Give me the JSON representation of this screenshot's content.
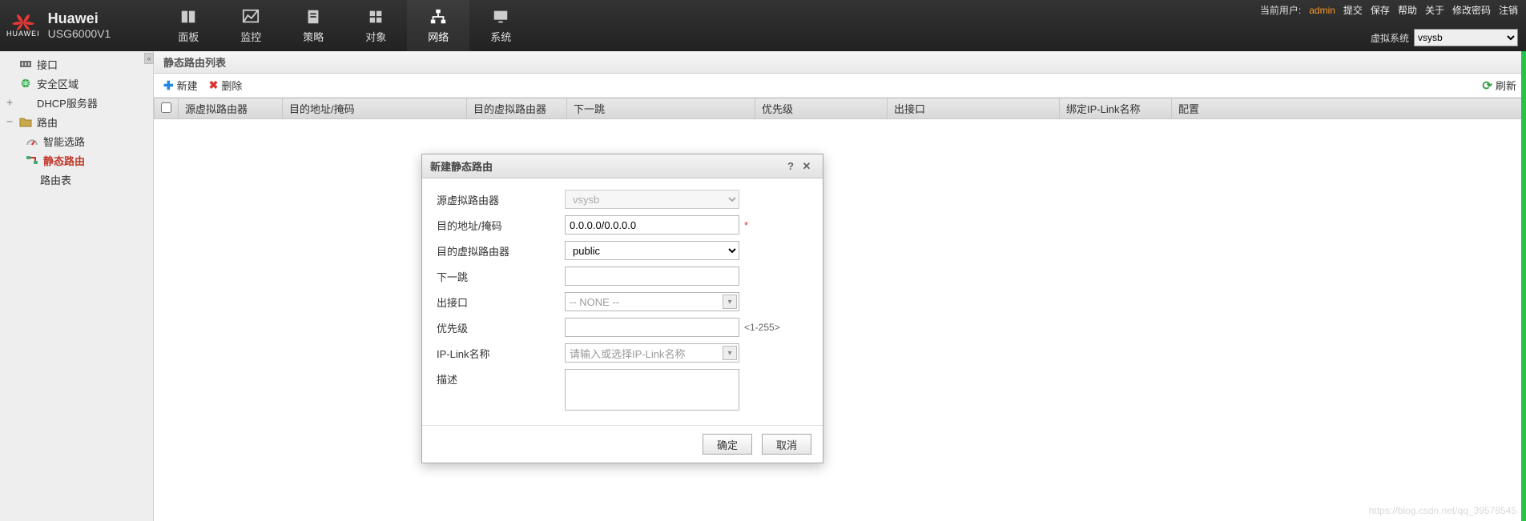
{
  "brand": {
    "name": "Huawei",
    "model": "USG6000V1",
    "logo_label": "HUAWEI"
  },
  "nav": {
    "items": [
      {
        "key": "dashboard",
        "label": "面板"
      },
      {
        "key": "monitor",
        "label": "监控"
      },
      {
        "key": "policy",
        "label": "策略"
      },
      {
        "key": "object",
        "label": "对象"
      },
      {
        "key": "network",
        "label": "网络",
        "active": true
      },
      {
        "key": "system",
        "label": "系统"
      }
    ]
  },
  "top_right": {
    "current_user_label": "当前用户:",
    "current_user": "admin",
    "links": [
      "提交",
      "保存",
      "帮助",
      "关于",
      "修改密码",
      "注销"
    ],
    "vsys_label": "虚拟系统",
    "vsys_value": "vsysb"
  },
  "sidebar": {
    "items": [
      {
        "key": "interface",
        "label": "接口",
        "level": 1,
        "icon": "port-icon"
      },
      {
        "key": "seczone",
        "label": "安全区域",
        "level": 1,
        "icon": "globe-icon"
      },
      {
        "key": "dhcp",
        "label": "DHCP服务器",
        "level": 2,
        "twisty": "+"
      },
      {
        "key": "route",
        "label": "路由",
        "level": 1,
        "icon": "folder-icon",
        "twisty": "−"
      },
      {
        "key": "smartroute",
        "label": "智能选路",
        "level": 2,
        "icon": "gauge-icon"
      },
      {
        "key": "static",
        "label": "静态路由",
        "level": 2,
        "icon": "route-icon",
        "active": true
      },
      {
        "key": "rtable",
        "label": "路由表",
        "level": 3
      }
    ]
  },
  "panel": {
    "title": "静态路由列表"
  },
  "toolbar": {
    "new": "新建",
    "delete": "删除",
    "refresh": "刷新"
  },
  "columns": [
    "源虚拟路由器",
    "目的地址/掩码",
    "目的虚拟路由器",
    "下一跳",
    "优先级",
    "出接口",
    "绑定IP-Link名称",
    "配置"
  ],
  "dialog": {
    "title": "新建静态路由",
    "fields": {
      "src_vr": {
        "label": "源虚拟路由器",
        "value": "vsysb"
      },
      "dest": {
        "label": "目的地址/掩码",
        "value": "0.0.0.0/0.0.0.0",
        "required": "*"
      },
      "dest_vr": {
        "label": "目的虚拟路由器",
        "value": "public"
      },
      "nexthop": {
        "label": "下一跳",
        "value": ""
      },
      "outif": {
        "label": "出接口",
        "value": "-- NONE --"
      },
      "priority": {
        "label": "优先级",
        "value": "",
        "hint": "<1-255>"
      },
      "iplink": {
        "label": "IP-Link名称",
        "placeholder": "请输入或选择IP-Link名称"
      },
      "desc": {
        "label": "描述",
        "value": ""
      }
    },
    "ok": "确定",
    "cancel": "取消"
  },
  "watermark": "https://blog.csdn.net/qq_39578545"
}
